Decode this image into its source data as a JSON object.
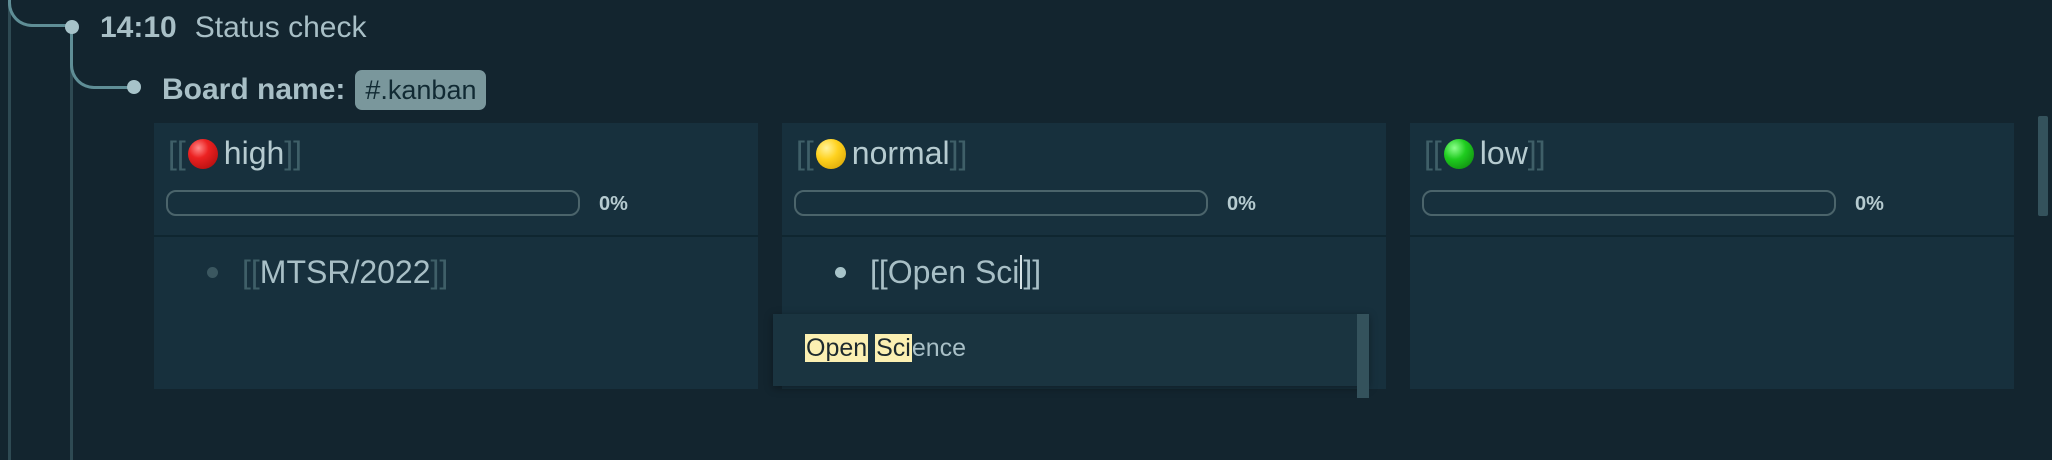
{
  "status_block": {
    "time": "14:10",
    "text": "Status check"
  },
  "board_prop": {
    "key": "Board name:",
    "value": "#.kanban"
  },
  "columns": [
    {
      "open": "[[",
      "title": "high",
      "close": "]]",
      "emoji": "red-circle",
      "percent_label": "0%",
      "progress": 0
    },
    {
      "open": "[[",
      "title": "normal",
      "close": "]]",
      "emoji": "yellow-circle",
      "percent_label": "0%",
      "progress": 0
    },
    {
      "open": "[[",
      "title": "low",
      "close": "]]",
      "emoji": "green-circle",
      "percent_label": "0%",
      "progress": 0
    }
  ],
  "cards": {
    "high": {
      "open": "[[",
      "text": "MTSR/2022",
      "close": "]]"
    },
    "normal": {
      "before_caret": "[[Open Sci",
      "after_caret": "]]"
    }
  },
  "autocomplete": {
    "match1": "Open",
    "space": " ",
    "match2": "Sci",
    "rest": "ence"
  },
  "colors": {
    "background": "#13252f",
    "column": "#17303d",
    "highlight": "#fbf0b2",
    "tag": "#7a979c"
  }
}
